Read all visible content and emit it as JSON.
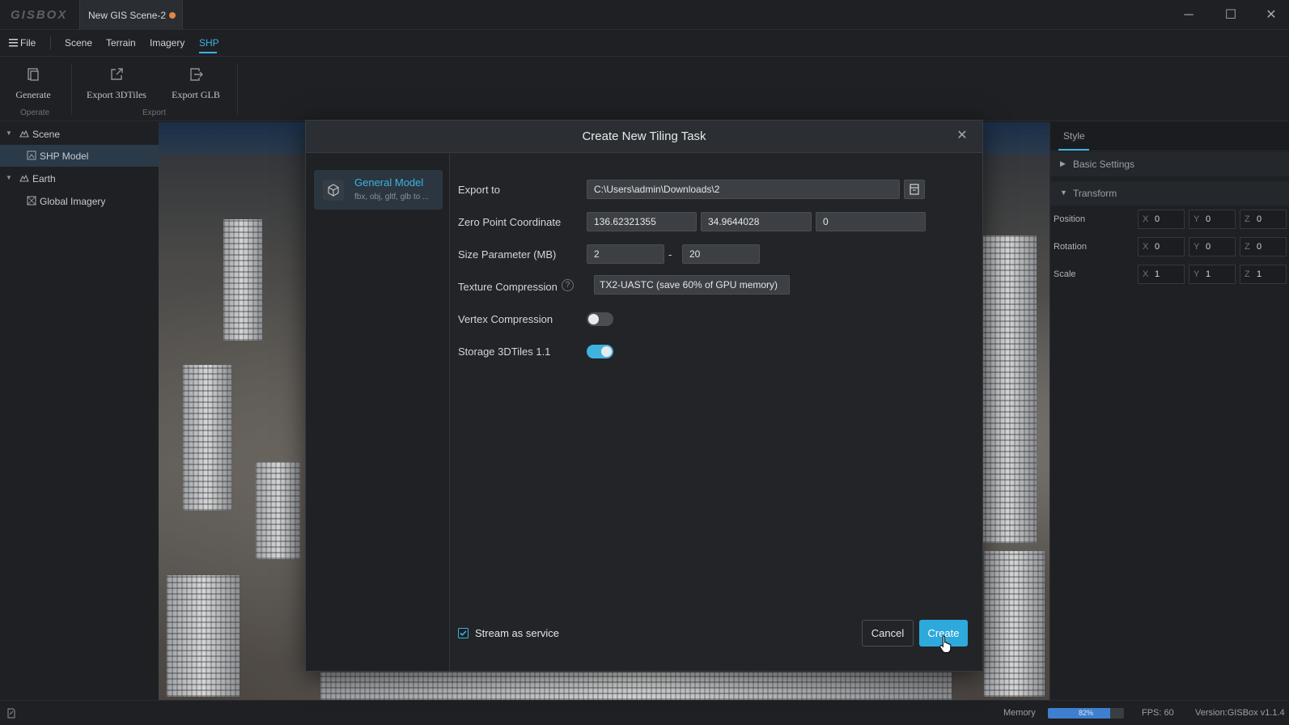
{
  "app": {
    "logo": "GISBOX",
    "doc_tab": "New GIS Scene-2",
    "colors": {
      "accent": "#3fb3e0",
      "unsaved_dot": "#e0884a",
      "memory_fill": "#3f7fd0"
    }
  },
  "window_controls": {
    "minimize": "─",
    "maximize": "☐",
    "close": "✕"
  },
  "menu": {
    "file": "File",
    "items": [
      "Scene",
      "Terrain",
      "Imagery",
      "SHP"
    ],
    "active": "SHP"
  },
  "ribbon": {
    "buttons": [
      {
        "label": "Generate",
        "icon": "generate-icon"
      },
      {
        "label": "Export 3DTiles",
        "icon": "export-3dtiles-icon"
      },
      {
        "label": "Export GLB",
        "icon": "export-glb-icon"
      }
    ],
    "groups": [
      "Operate",
      "Export"
    ]
  },
  "tree": {
    "items": [
      {
        "label": "Scene",
        "icon": "scene-icon",
        "expanded": true
      },
      {
        "label": "SHP Model",
        "icon": "model-icon",
        "selected": true
      },
      {
        "label": "Earth",
        "icon": "earth-icon",
        "expanded": true
      },
      {
        "label": "Global Imagery",
        "icon": "imagery-icon"
      }
    ]
  },
  "right_panel": {
    "tab": "Style",
    "sections": [
      "Basic Settings",
      "Transform"
    ],
    "transform": [
      {
        "label": "Position",
        "x": "0",
        "y": "0",
        "z": "0"
      },
      {
        "label": "Rotation",
        "x": "0",
        "y": "0",
        "z": "0"
      },
      {
        "label": "Scale",
        "x": "1",
        "y": "1",
        "z": "1"
      }
    ],
    "axis_labels": [
      "X",
      "Y",
      "Z"
    ]
  },
  "dialog": {
    "title": "Create New Tiling Task",
    "model_type": {
      "title": "General Model",
      "subtitle": "fbx, obj, gltf, glb to ..."
    },
    "export_to": {
      "label": "Export to",
      "value": "C:\\Users\\admin\\Downloads\\2"
    },
    "zero_point": {
      "label": "Zero Point Coordinate",
      "x": "136.62321355",
      "y": "34.9644028",
      "z": "0"
    },
    "size_param": {
      "label": "Size Parameter (MB)",
      "min": "2",
      "separator": "-",
      "max": "20"
    },
    "texture_compression": {
      "label": "Texture Compression",
      "help": "?",
      "value": "TX2-UASTC (save 60% of GPU memory)"
    },
    "vertex_compression": {
      "label": "Vertex Compression",
      "enabled": false
    },
    "storage_3dtiles": {
      "label": "Storage 3DTiles 1.1",
      "enabled": true
    },
    "stream_as_service": {
      "label": "Stream as service",
      "checked": true
    },
    "cancel_label": "Cancel",
    "create_label": "Create"
  },
  "status": {
    "memory_label": "Memory",
    "memory_percent": 82,
    "memory_text": "82%",
    "fps": "FPS: 60",
    "version": "Version:GISBox v1.1.4"
  }
}
